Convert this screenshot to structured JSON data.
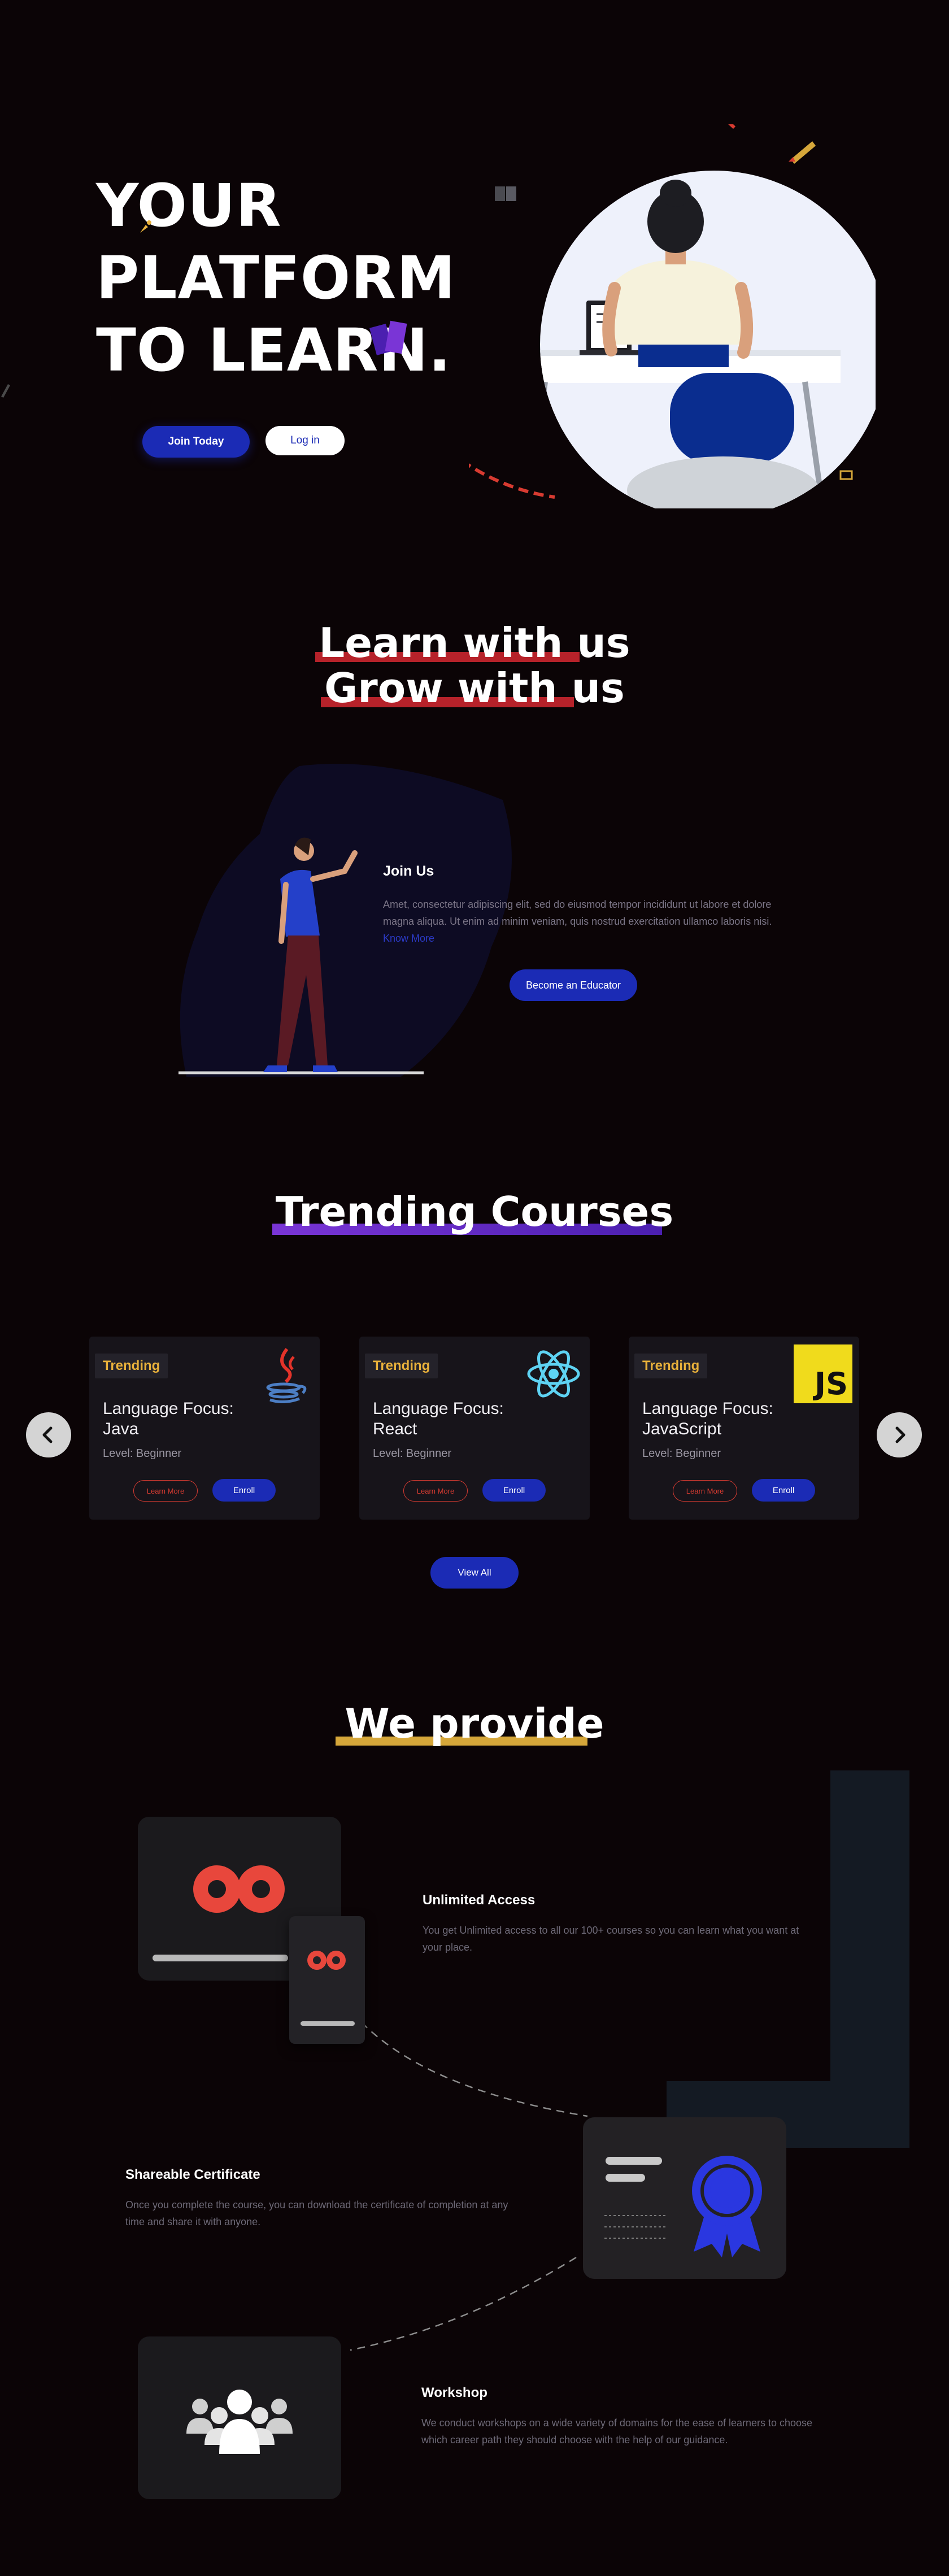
{
  "hero": {
    "title_lines": [
      "YOUR",
      "PLATFORM",
      "TO LEARN."
    ],
    "join_button": "Join Today",
    "login_button": "Log in"
  },
  "learn_section": {
    "title_line1": "Learn with us",
    "title_line2": "Grow with us",
    "join_heading": "Join Us",
    "join_text": "Amet, consectetur adipiscing elit, sed do eiusmod tempor incididunt ut labore et dolore magna aliqua. Ut enim ad minim veniam, quis nostrud exercitation ullamco laboris nisi.",
    "know_more": "Know More",
    "educator_button": "Become an Educator"
  },
  "trending": {
    "title": "Trending Courses",
    "courses": [
      {
        "badge": "Trending",
        "name": "Language Focus: Java",
        "level": "Level: Beginner",
        "learn_more": "Learn More",
        "enroll": "Enroll",
        "icon": "java-icon"
      },
      {
        "badge": "Trending",
        "name": "Language Focus: React",
        "level": "Level: Beginner",
        "learn_more": "Learn More",
        "enroll": "Enroll",
        "icon": "react-icon"
      },
      {
        "badge": "Trending",
        "name": "Language Focus: JavaScript",
        "level": "Level: Beginner",
        "learn_more": "Learn More",
        "enroll": "Enroll",
        "icon": "javascript-icon",
        "logo_text": "JS"
      }
    ],
    "view_all": "View All"
  },
  "provide": {
    "title": "We provide",
    "features": [
      {
        "title": "Unlimited Access",
        "text": "You get Unlimited access to all our 100+ courses so you can learn what you want at your place."
      },
      {
        "title": "Shareable Certificate",
        "text": "Once you complete the course, you can download the certificate of completion at any time and share it with anyone."
      },
      {
        "title": "Workshop",
        "text": "We conduct workshops on a wide variety of domains for the ease of learners to choose which career path they should choose with the help of our guidance."
      }
    ]
  },
  "colors": {
    "background": "#0b0406",
    "primary": "#1b2bb5",
    "accent_red": "#d83b31",
    "accent_purple": "#7a35d6",
    "accent_gold": "#d6a73a",
    "badge_text": "#e9b13b"
  }
}
